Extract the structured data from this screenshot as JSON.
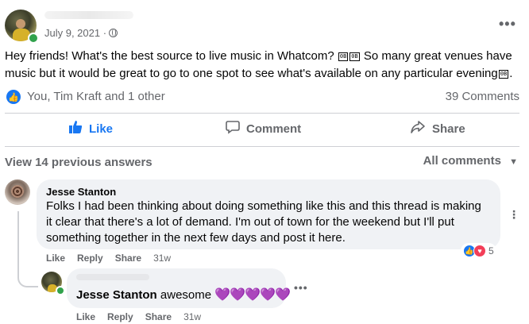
{
  "post": {
    "date": "July 9, 2021 ·",
    "text_part1": "Hey friends! What's the best source to live music in Whatcom? ",
    "emoji_placeholder_a": "🎶",
    "emoji_placeholder_b": "🎸",
    "text_part2": " So many great venues have music but it would be great to go to one spot to see what's available on any particular evening",
    "emoji_placeholder_c": "🎵",
    "text_part3": ".",
    "emoji_box_a": "0⃣ 1⃣",
    "emoji_box_b": "0⃣ 1⃣"
  },
  "reactions": {
    "summary": "You, Tim Kraft and 1 other",
    "comments_count": "39 Comments"
  },
  "actions": {
    "like": "Like",
    "comment": "Comment",
    "share": "Share"
  },
  "comments_header": {
    "view_previous": "View 14 previous answers",
    "sort": "All comments"
  },
  "comment1": {
    "author": "Jesse Stanton",
    "line1": "Folks I had been thinking about doing something like this and this thread is making",
    "line2": "it clear that there's a lot of demand. I'm out of town for the weekend but I'll put",
    "line3": "something together in the next few days and post it here.",
    "like": "Like",
    "reply": "Reply",
    "share": "Share",
    "time": "31w",
    "reaction_count": "5"
  },
  "reply1": {
    "author": "Jesse Stanton",
    "text": "awesome",
    "hearts": "💜💜💜💜💜",
    "like": "Like",
    "reply": "Reply",
    "share": "Share",
    "time": "31w"
  },
  "colors": {
    "accent": "#1877f2",
    "secondary_text": "#65676b",
    "bubble": "#f0f2f5",
    "love": "#f33e58",
    "heart_purple": "#8a35d6"
  }
}
